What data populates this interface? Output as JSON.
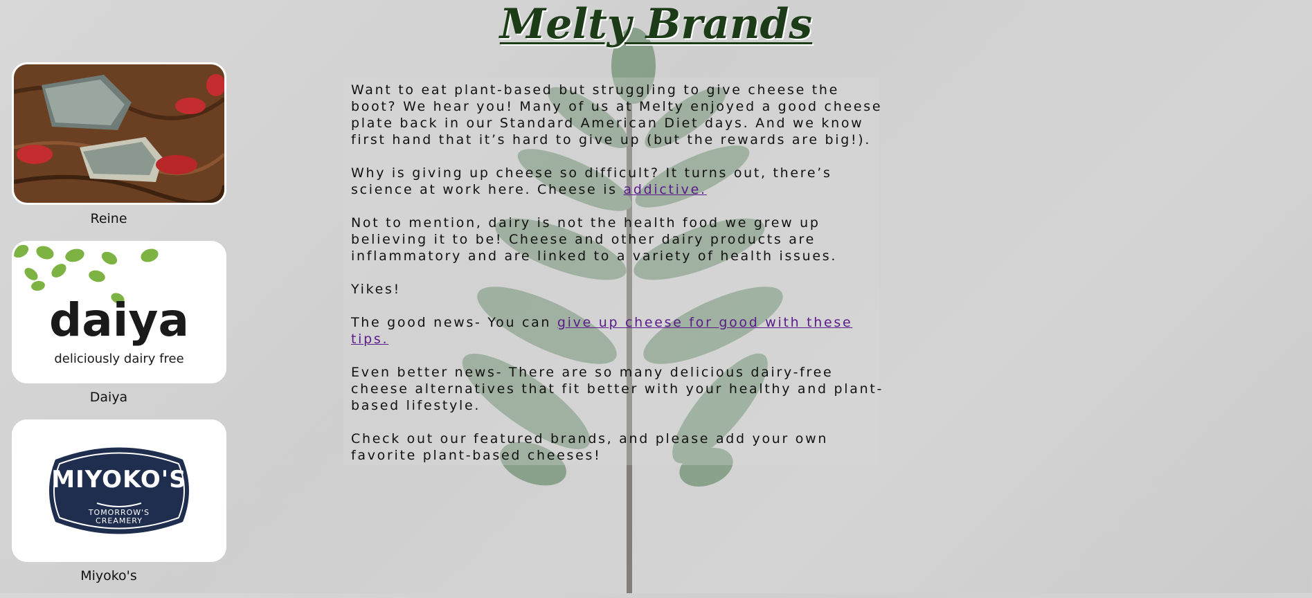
{
  "header": {
    "title": "Melty Brands"
  },
  "article": {
    "p1": "Want to eat plant-based but struggling to give cheese the boot? We hear you! Many of us at Melty enjoyed a good cheese plate back in our Standard American Diet days. And we know first hand that it’s hard to give up (but the rewards are big!).",
    "p2_text": "Why is giving up cheese so difficult? It turns out, there’s science at work here. Cheese is ",
    "p2_link": "addictive.",
    "p3": "Not to mention, dairy is not the health food we grew up believing it to be! Cheese and other dairy products are inflammatory and are linked to a variety of health issues.",
    "p4": "Yikes!",
    "p5_text": "The good news- You can ",
    "p5_link": "give up cheese for good with these tips.",
    "p6": "Even better news- There are so many delicious dairy-free cheese alternatives that fit better with your healthy and plant-based lifestyle.",
    "p7": "Check out our featured brands, and please add your own favorite plant-based cheeses!"
  },
  "brands": [
    {
      "name": "Reine"
    },
    {
      "name": "Daiya",
      "logo_text": "daiya",
      "tagline": "deliciously dairy free"
    },
    {
      "name": "Miyoko's",
      "logo_text": "MIYOKO'S",
      "tagline_line1": "TOMORROW'S",
      "tagline_line2": "CREAMERY"
    }
  ],
  "colors": {
    "title": "#1c3b17",
    "link": "#5a1a8a",
    "leaf": "#4f7a52",
    "miyoko_navy": "#1f2d4e",
    "daiya_green": "#7cb342"
  }
}
